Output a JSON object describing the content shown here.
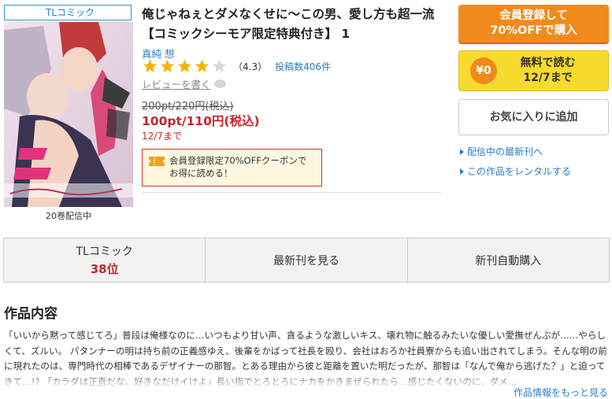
{
  "genre_tag": "TLコミック",
  "title": "俺じゃねぇとダメなくせに～この男、愛し方も超一流【コミックシーモア限定特典付き】 1",
  "author": "真純 想",
  "rating": {
    "stars": 4,
    "value": "（4.3）",
    "review_count": "投稿数406件"
  },
  "write_review": "レビューを書く",
  "price": {
    "old": "200pt/220円(税込)",
    "new": "100pt/110円(税込)",
    "until": "12/7まで"
  },
  "coupon": {
    "text": "会員登録限定70%OFFクーポンで お得に読める！"
  },
  "volumes_text": "20巻配信中",
  "buttons": {
    "register_line1": "会員登録して",
    "register_line2": "70%OFFで購入",
    "free_icon": "¥0",
    "free_line1": "無料で読む",
    "free_line2": "12/7まで",
    "favorite": "お気に入りに追加"
  },
  "side_links": [
    "配信中の最新刊へ",
    "この作品をレンタルする"
  ],
  "tabs": {
    "genre": "TLコミック",
    "rank": "38位",
    "latest": "最新刊を見る",
    "auto_buy": "新刊自動購入"
  },
  "section_title": "作品内容",
  "description": "「いいから黙って感じてろ」普段は俺様なのに…いつもより甘い声、貪るような激しいキス、壊れ物に触るみたいな優しい愛撫ぜんぶが……やらしくて、ズルい。 パタンナーの明は持ち前の正義感ゆえ、後輩をかばって社長を殴り、会社はおろか社員寮からも追い出されてしまう。そんな明の前に現れたのは、専門時代の相棒であるデザイナーの那智。とある理由から彼と距離を置いた明だったが、那智は「なんで俺から逃げた？」と迫ってきて…!? 「カラダは正直だな。好きなだけイけよ」長い指でとろとろにナカをかきまぜられたら…感じたくないのに、ダメ…",
  "more_link": "作品情報をもっと見る",
  "colors": {
    "accent_blue": "#2a7fc4",
    "price_red": "#c1272d",
    "register_orange": "#f08a1c",
    "free_yellow": "#f7da2e",
    "star_gold": "#f5b301"
  }
}
